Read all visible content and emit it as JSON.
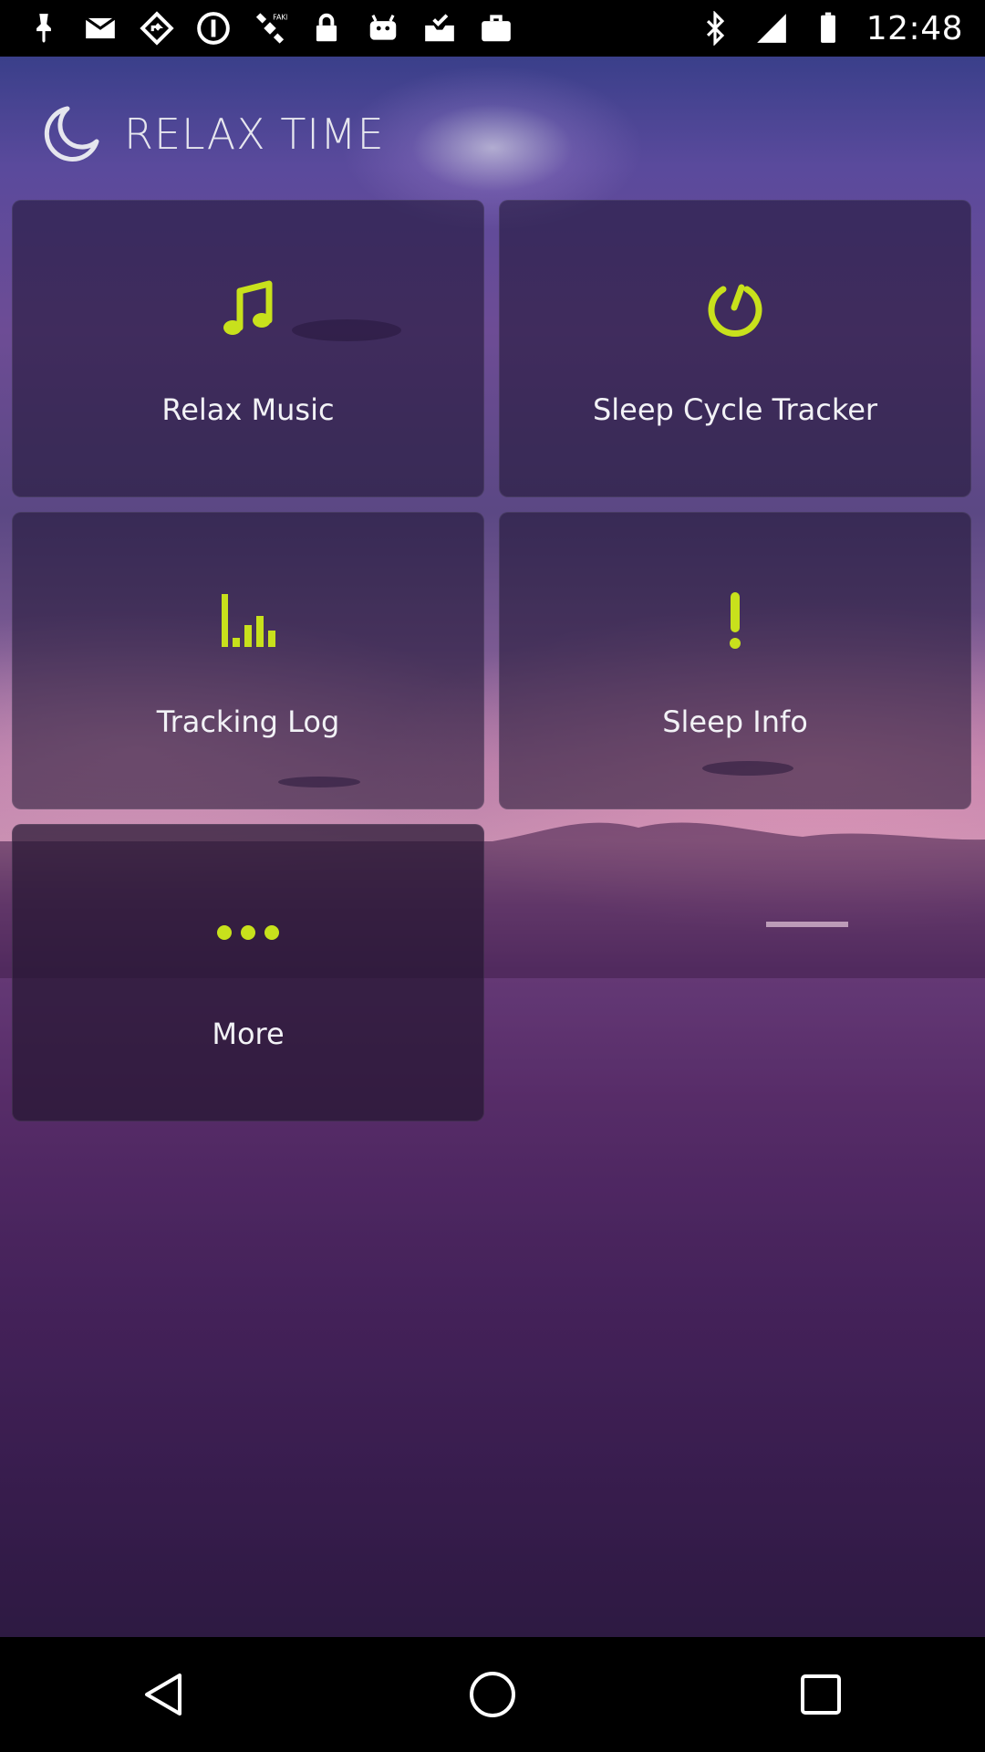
{
  "status_bar": {
    "time": "12:48",
    "left_icons": [
      "notification-pin-icon",
      "mail-icon",
      "navigation-diamond-icon",
      "do-not-disturb-icon",
      "satellite-icon",
      "lock-icon",
      "android-icon",
      "checked-inbox-icon",
      "briefcase-icon"
    ],
    "right_icons": [
      "bluetooth-icon",
      "signal-icon",
      "battery-icon"
    ]
  },
  "header": {
    "title": "RELAX TIME",
    "icon": "moon-icon"
  },
  "tiles": [
    {
      "label": "Relax Music",
      "icon": "music-note-icon"
    },
    {
      "label": "Sleep Cycle Tracker",
      "icon": "power-timer-icon"
    },
    {
      "label": "Tracking Log",
      "icon": "bar-chart-icon"
    },
    {
      "label": "Sleep Info",
      "icon": "exclamation-icon"
    },
    {
      "label": "More",
      "icon": "more-dots-icon"
    }
  ],
  "colors": {
    "accent": "#c8e11c",
    "tile_text": "#f2f2f6",
    "title_text": "#e6e6ee"
  },
  "nav_bar": {
    "buttons": [
      "back-icon",
      "home-icon",
      "recents-icon"
    ]
  }
}
